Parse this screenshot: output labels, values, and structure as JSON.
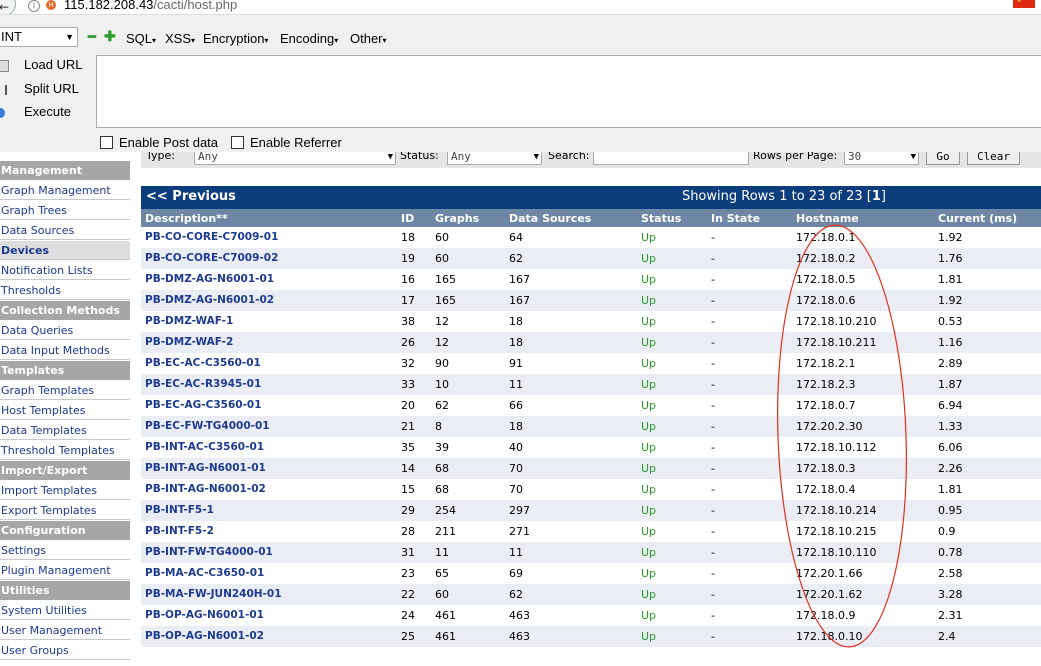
{
  "browser": {
    "url_host": "115.182.208.43",
    "url_path": "/cacti/host.php"
  },
  "hackbar": {
    "select_value": "INT",
    "menus": [
      "SQL",
      "XSS",
      "Encryption",
      "Encoding",
      "Other"
    ],
    "actions": {
      "load": "Load URL",
      "split": "Split URL",
      "execute": "Execute"
    },
    "enable_post": "Enable Post data",
    "enable_referrer": "Enable Referrer"
  },
  "sidebar": {
    "items": [
      {
        "type": "header",
        "label": "Management"
      },
      {
        "type": "item",
        "label": "Graph Management"
      },
      {
        "type": "item",
        "label": "Graph Trees"
      },
      {
        "type": "item",
        "label": "Data Sources"
      },
      {
        "type": "active",
        "label": "Devices"
      },
      {
        "type": "item",
        "label": "Notification Lists"
      },
      {
        "type": "item",
        "label": "Thresholds"
      },
      {
        "type": "header",
        "label": "Collection Methods"
      },
      {
        "type": "item",
        "label": "Data Queries"
      },
      {
        "type": "item",
        "label": "Data Input Methods"
      },
      {
        "type": "header",
        "label": "Templates"
      },
      {
        "type": "item",
        "label": "Graph Templates"
      },
      {
        "type": "item",
        "label": "Host Templates"
      },
      {
        "type": "item",
        "label": "Data Templates"
      },
      {
        "type": "item",
        "label": "Threshold Templates"
      },
      {
        "type": "header",
        "label": "Import/Export"
      },
      {
        "type": "item",
        "label": "Import Templates"
      },
      {
        "type": "item",
        "label": "Export Templates"
      },
      {
        "type": "header",
        "label": "Configuration"
      },
      {
        "type": "item",
        "label": "Settings"
      },
      {
        "type": "item",
        "label": "Plugin Management"
      },
      {
        "type": "header",
        "label": "Utilities"
      },
      {
        "type": "item",
        "label": "System Utilities"
      },
      {
        "type": "item",
        "label": "User Management"
      },
      {
        "type": "item",
        "label": "User Groups"
      }
    ]
  },
  "filters": {
    "type_label": "Type:",
    "type_value": "Any",
    "status_label": "Status:",
    "status_value": "Any",
    "search_label": "Search:",
    "search_value": "",
    "rows_label": "Rows per Page:",
    "rows_value": "30",
    "go": "Go",
    "clear": "Clear"
  },
  "table": {
    "prev": "<< Previous",
    "showing": "Showing Rows 1 to 23 of 23",
    "page": "1",
    "columns": [
      "Description**",
      "ID",
      "Graphs",
      "Data Sources",
      "Status",
      "In State",
      "Hostname",
      "Current (ms)"
    ],
    "rows": [
      [
        "PB-CO-CORE-C7009-01",
        "18",
        "60",
        "64",
        "Up",
        "-",
        "172.18.0.1",
        "1.92"
      ],
      [
        "PB-CO-CORE-C7009-02",
        "19",
        "60",
        "62",
        "Up",
        "-",
        "172.18.0.2",
        "1.76"
      ],
      [
        "PB-DMZ-AG-N6001-01",
        "16",
        "165",
        "167",
        "Up",
        "-",
        "172.18.0.5",
        "1.81"
      ],
      [
        "PB-DMZ-AG-N6001-02",
        "17",
        "165",
        "167",
        "Up",
        "-",
        "172.18.0.6",
        "1.92"
      ],
      [
        "PB-DMZ-WAF-1",
        "38",
        "12",
        "18",
        "Up",
        "-",
        "172.18.10.210",
        "0.53"
      ],
      [
        "PB-DMZ-WAF-2",
        "26",
        "12",
        "18",
        "Up",
        "-",
        "172.18.10.211",
        "1.16"
      ],
      [
        "PB-EC-AC-C3560-01",
        "32",
        "90",
        "91",
        "Up",
        "-",
        "172.18.2.1",
        "2.89"
      ],
      [
        "PB-EC-AC-R3945-01",
        "33",
        "10",
        "11",
        "Up",
        "-",
        "172.18.2.3",
        "1.87"
      ],
      [
        "PB-EC-AG-C3560-01",
        "20",
        "62",
        "66",
        "Up",
        "-",
        "172.18.0.7",
        "6.94"
      ],
      [
        "PB-EC-FW-TG4000-01",
        "21",
        "8",
        "18",
        "Up",
        "-",
        "172.20.2.30",
        "1.33"
      ],
      [
        "PB-INT-AC-C3560-01",
        "35",
        "39",
        "40",
        "Up",
        "-",
        "172.18.10.112",
        "6.06"
      ],
      [
        "PB-INT-AG-N6001-01",
        "14",
        "68",
        "70",
        "Up",
        "-",
        "172.18.0.3",
        "2.26"
      ],
      [
        "PB-INT-AG-N6001-02",
        "15",
        "68",
        "70",
        "Up",
        "-",
        "172.18.0.4",
        "1.81"
      ],
      [
        "PB-INT-F5-1",
        "29",
        "254",
        "297",
        "Up",
        "-",
        "172.18.10.214",
        "0.95"
      ],
      [
        "PB-INT-F5-2",
        "28",
        "211",
        "271",
        "Up",
        "-",
        "172.18.10.215",
        "0.9"
      ],
      [
        "PB-INT-FW-TG4000-01",
        "31",
        "11",
        "11",
        "Up",
        "-",
        "172.18.10.110",
        "0.78"
      ],
      [
        "PB-MA-AC-C3650-01",
        "23",
        "65",
        "69",
        "Up",
        "-",
        "172.20.1.66",
        "2.58"
      ],
      [
        "PB-MA-FW-JUN240H-01",
        "22",
        "60",
        "62",
        "Up",
        "-",
        "172.20.1.62",
        "3.28"
      ],
      [
        "PB-OP-AG-N6001-01",
        "24",
        "461",
        "463",
        "Up",
        "-",
        "172.18.0.9",
        "2.31"
      ],
      [
        "PB-OP-AG-N6001-02",
        "25",
        "461",
        "463",
        "Up",
        "-",
        "172.18.0.10",
        "2.4"
      ]
    ]
  },
  "colors": {
    "nav_bar": "#0c3d7c",
    "column_header": "#6d87a5",
    "link": "#1c3b8f",
    "status_up": "#2a9a2a",
    "annotation": "#e0301e",
    "sidebar_header": "#a6a6a6"
  }
}
